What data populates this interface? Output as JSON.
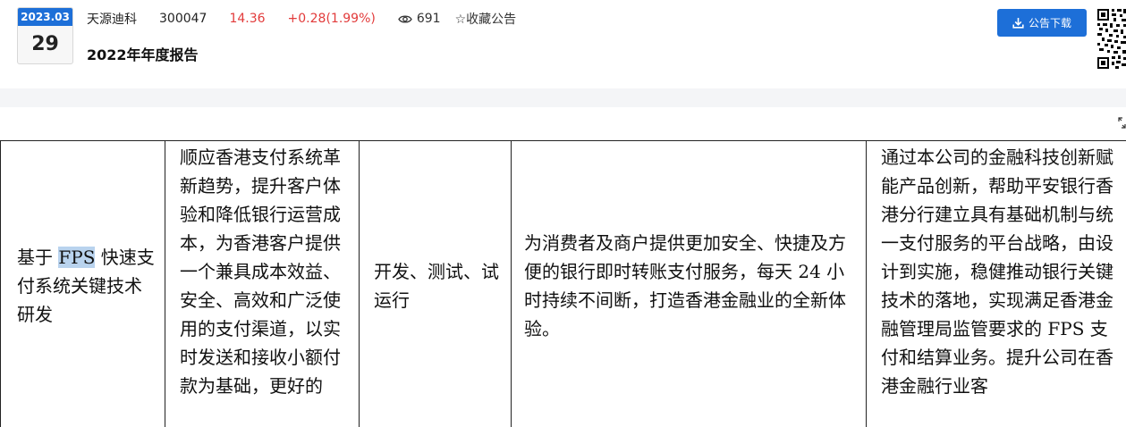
{
  "date": {
    "year_month": "2023.03",
    "day": "29"
  },
  "stock": {
    "name": "天源迪科",
    "code": "300047",
    "price": "14.36",
    "change": "+0.28(1.99%)",
    "views": "691",
    "favorite_label": "☆收藏公告"
  },
  "report_title": "2022年年度报告",
  "download_label": "公告下载",
  "colors": {
    "accent": "#1d6fd8",
    "up": "#e23b3b",
    "band": "#f4f5f7"
  },
  "table": {
    "project_prefix": "基于 ",
    "project_highlight": "FPS",
    "project_suffix": " 快速支付系统关键技术研发",
    "purpose": "顺应香港支付系统革新趋势，提升客户体验和降低银行运营成本，为香港客户提供一个兼具成本效益、安全、高效和广泛使用的支付渠道，以实时发送和接收小额付款为基础，更好的",
    "progress": "开发、测试、试运行",
    "goal": "为消费者及商户提供更加安全、快捷及方便的银行即时转账支付服务，每天 24 小时持续不间断，打造香港金融业的全新体验。",
    "impact": "通过本公司的金融科技创新赋能产品创新，帮助平安银行香港分行建立具有基础机制与统一支付服务的平台战略，由设计到实施，稳健推动银行关键技术的落地，实现满足香港金融管理局监管要求的 FPS 支付和结算业务。提升公司在香港金融行业客"
  }
}
